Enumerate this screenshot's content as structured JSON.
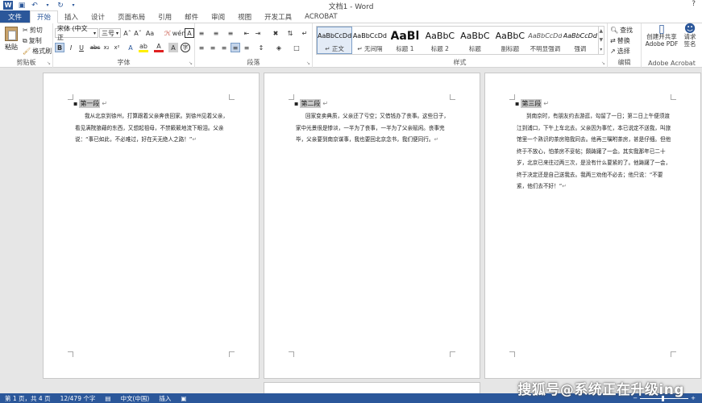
{
  "title_bar": {
    "app_logo": "W",
    "document_title": "文档1 - Word",
    "help": "?"
  },
  "tabs": [
    {
      "label": "文件"
    },
    {
      "label": "开始"
    },
    {
      "label": "插入"
    },
    {
      "label": "设计"
    },
    {
      "label": "页面布局"
    },
    {
      "label": "引用"
    },
    {
      "label": "邮件"
    },
    {
      "label": "审阅"
    },
    {
      "label": "视图"
    },
    {
      "label": "开发工具"
    },
    {
      "label": "ACROBAT"
    }
  ],
  "ribbon": {
    "clipboard": {
      "paste": "粘贴",
      "cut": "剪切",
      "copy": "复制",
      "format_painter": "格式刷",
      "label": "剪贴板"
    },
    "font": {
      "font_name": "宋体 (中文正",
      "font_size": "三号",
      "label": "字体"
    },
    "paragraph": {
      "label": "段落"
    },
    "styles": {
      "label": "样式",
      "items": [
        {
          "sample": "AaBbCcDd",
          "name": "↵ 正文"
        },
        {
          "sample": "AaBbCcDd",
          "name": "↵ 无间隔"
        },
        {
          "sample": "AaBl",
          "name": "标题 1"
        },
        {
          "sample": "AaBbC",
          "name": "标题 2"
        },
        {
          "sample": "AaBbC",
          "name": "标题"
        },
        {
          "sample": "AaBbC",
          "name": "副标题"
        },
        {
          "sample": "AaBbCcDd",
          "name": "不明显强调"
        },
        {
          "sample": "AaBbCcDd",
          "name": "强调"
        }
      ]
    },
    "editing": {
      "find": "查找",
      "replace": "替换",
      "select": "选择",
      "label": "编辑"
    },
    "acrobat": {
      "create_share": "创建并共享",
      "adobe_pdf": "Adobe PDF",
      "request": "请求",
      "sign": "签名",
      "label": "Adobe Acrobat"
    }
  },
  "pages": [
    {
      "heading": "第一段",
      "text": "我从北京到徐州，打算跟着父亲奔丧回家。到徐州见着父亲，看见满院狼藉的东西，又想起祖母，不禁簌簌地流下眼泪。父亲说：“事已如此，不必难过，好在天无绝人之路！”"
    },
    {
      "heading": "第二段",
      "text": "回家变卖典质，父亲还了亏空；又借钱办了丧事。这些日子，家中光景很是惨淡，一半为了丧事，一半为了父亲赋闲。丧事完毕，父亲要到南京谋事，我也要回北京念书，我们便同行。"
    },
    {
      "heading": "第三段",
      "text": "到南京时，有朋友约去游逛，勾留了一日；第二日上午便须渡江到浦口，下午上车北去。父亲因为事忙，本已说定不送我，叫旅馆里一个熟识的茶房陪我同去。他再三嘱咐茶房，甚是仔细。但他终于不放心，怕茶房不妥帖；颇踌躇了一会。其实我那年已二十岁，北京已来往过两三次，是没有什么要紧的了。他踌躇了一会，终于决定还是自己送我去。我两三劝他不必去；他只说：“不要紧，他们去不好！”"
    }
  ],
  "status_bar": {
    "page": "第 1 页，共 4 页",
    "words": "12/479 个字",
    "language": "中文(中国)",
    "mode": "插入"
  },
  "watermark": "搜狐号@系统正在升级ing",
  "colors": {
    "brand": "#2b579a"
  }
}
